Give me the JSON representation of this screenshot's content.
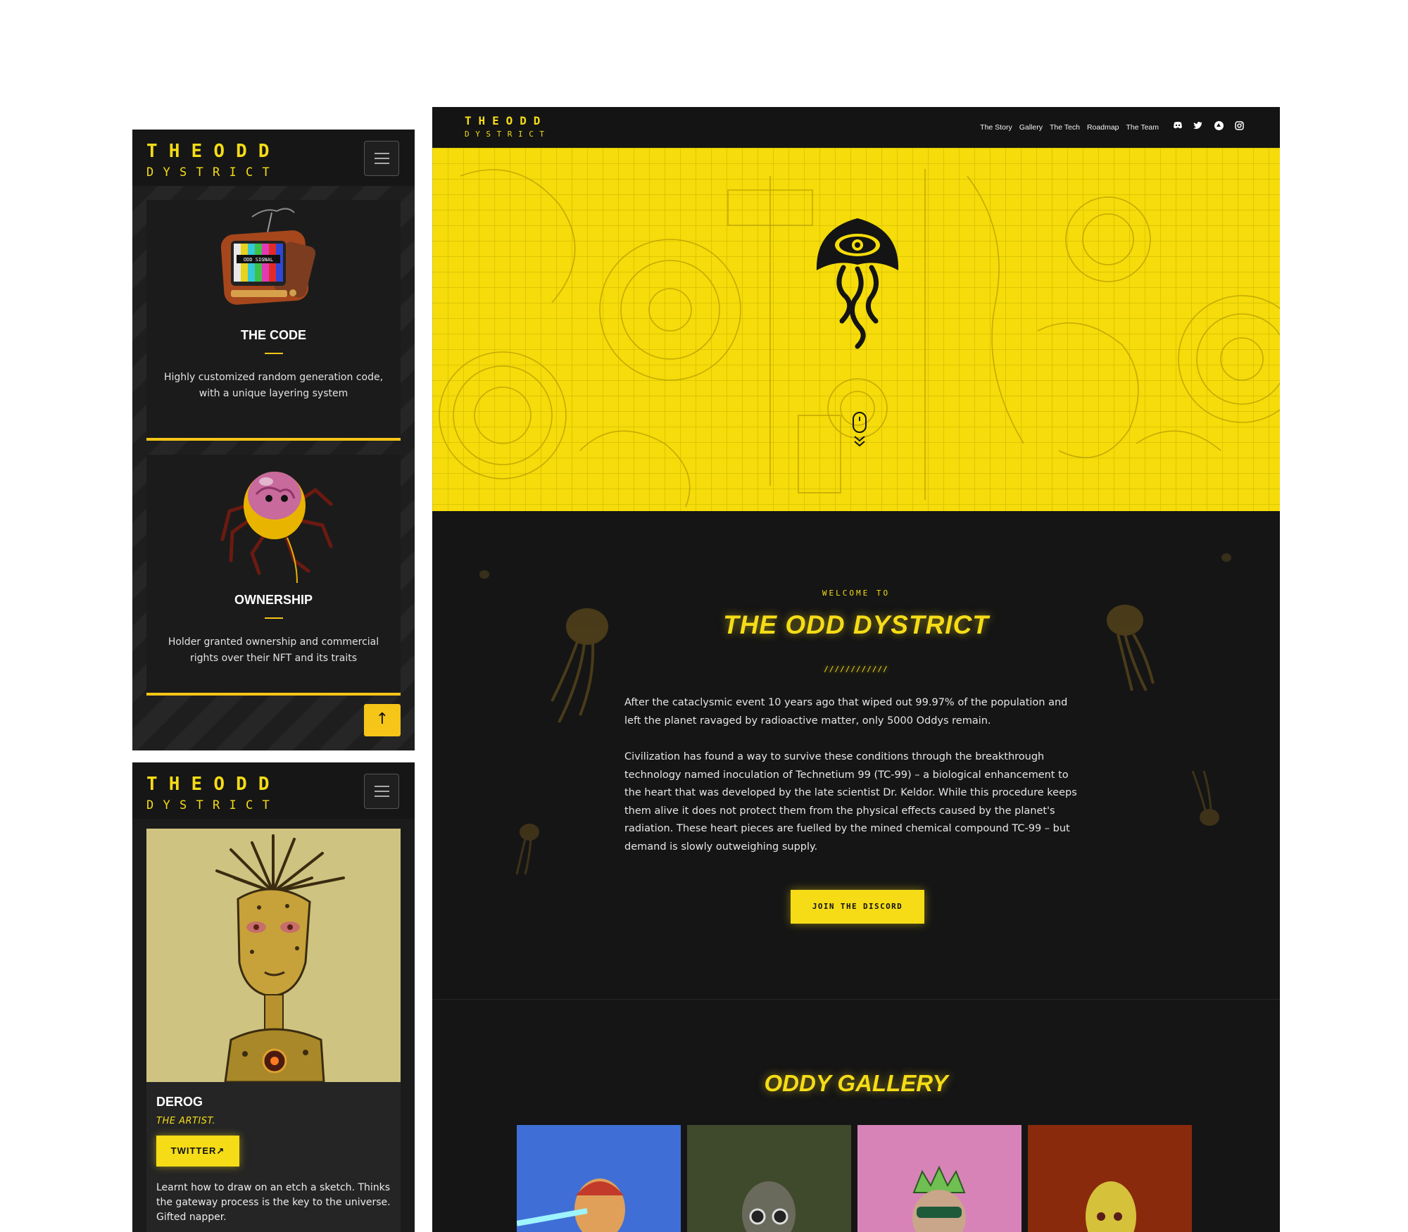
{
  "logo": {
    "line1": "THEODD",
    "line2": "DYSTRICT"
  },
  "mobile_features": {
    "items": [
      {
        "title": "THE CODE",
        "desc": "Highly customized random generation code, with a unique layering system",
        "image_label": "ODD SIGNAL"
      },
      {
        "title": "OWNERSHIP",
        "desc": "Holder granted ownership and commercial rights over their NFT and its traits"
      }
    ],
    "scroll_top_icon": "↑"
  },
  "mobile_team": {
    "name": "DEROG",
    "role": "THE ARTIST.",
    "twitter_label": "TWITTER",
    "twitter_icon": "↗",
    "bio": "Learnt how to draw on an etch a sketch. Thinks the gateway process is the key to the universe. Gifted napper."
  },
  "desktop": {
    "nav_links": [
      "The Story",
      "Gallery",
      "The Tech",
      "Roadmap",
      "The Team"
    ],
    "social_icons": [
      "discord-icon",
      "twitter-icon",
      "opensea-icon",
      "instagram-icon"
    ],
    "welcome": {
      "kicker": "WELCOME TO",
      "title": "THE ODD DYSTRICT",
      "divider": "////////////",
      "p1": "After the cataclysmic event 10 years ago that wiped out 99.97% of the population and left the planet ravaged by radioactive matter, only 5000 Oddys remain.",
      "p2": "Civilization has found a way to survive these conditions through the breakthrough technology named inoculation of Technetium 99 (TC-99) – a biological enhancement to the heart that was developed by the late scientist Dr. Keldor. While this procedure keeps them alive it does not protect them from the physical effects caused by the planet's radiation. These heart pieces are fuelled by the mined chemical compound TC-99 – but demand is slowly outweighing supply.",
      "cta": "JOIN THE DISCORD"
    },
    "gallery": {
      "title": "ODDY GALLERY",
      "tile_colors": [
        "#3f6fd6",
        "#3f4a2c",
        "#d883b8",
        "#8a2a0c"
      ]
    }
  },
  "colors": {
    "accent": "#f5dc17",
    "bg_dark": "#151515",
    "hero_yellow": "#f5dc0a"
  }
}
